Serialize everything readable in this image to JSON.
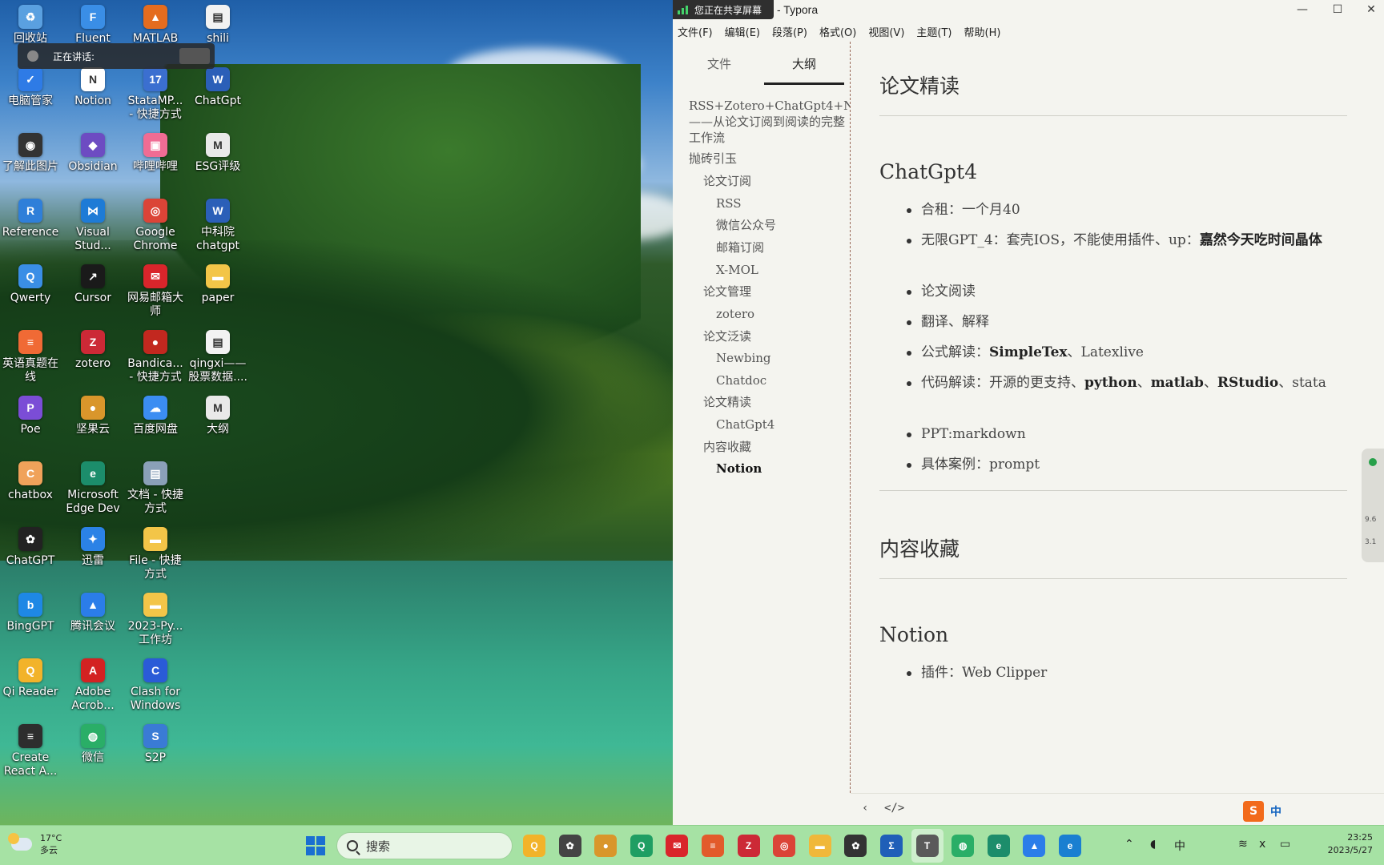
{
  "desktop": {
    "icons": [
      {
        "label": "回收站",
        "icon": "recycle-bin-icon",
        "color": "#5aa0e0",
        "glyph": "♻"
      },
      {
        "label": "电脑管家",
        "icon": "shield-icon",
        "color": "#2e7be6",
        "glyph": "✓"
      },
      {
        "label": "了解此图片",
        "icon": "camera-icon",
        "color": "#333333",
        "glyph": "◉"
      },
      {
        "label": "Reference",
        "icon": "reference-icon",
        "color": "#2f7fd9",
        "glyph": "R"
      },
      {
        "label": "Qwerty",
        "icon": "qwerty-icon",
        "color": "#3a8ee6",
        "glyph": "Q"
      },
      {
        "label": "英语真题在\n线",
        "icon": "exam-icon",
        "color": "#f06a35",
        "glyph": "≡"
      },
      {
        "label": "Poe",
        "icon": "poe-icon",
        "color": "#7b4dd6",
        "glyph": "P"
      },
      {
        "label": "chatbox",
        "icon": "chatbox-icon",
        "color": "#f0a25a",
        "glyph": "C"
      },
      {
        "label": "ChatGPT",
        "icon": "chatgpt-icon",
        "color": "#222222",
        "glyph": "✿"
      },
      {
        "label": "BingGPT",
        "icon": "bing-icon",
        "color": "#1e88e5",
        "glyph": "b"
      },
      {
        "label": "Qi Reader",
        "icon": "qi-reader-icon",
        "color": "#f2b32a",
        "glyph": "Q"
      },
      {
        "label": "Create\nReact A...",
        "icon": "create-react-icon",
        "color": "#2d2d2d",
        "glyph": "≡"
      },
      {
        "label": "Fluent",
        "icon": "fluent-icon",
        "color": "#3a8ee6",
        "glyph": "F"
      },
      {
        "label": "Notion",
        "icon": "notion-icon",
        "color": "#ffffff",
        "glyph": "N"
      },
      {
        "label": "Obsidian",
        "icon": "obsidian-icon",
        "color": "#6d4cc2",
        "glyph": "◆"
      },
      {
        "label": "Visual\nStud...",
        "icon": "vscode-icon",
        "color": "#1e7bd6",
        "glyph": "⋈"
      },
      {
        "label": "Cursor",
        "icon": "cursor-icon",
        "color": "#1a1a1a",
        "glyph": "↗"
      },
      {
        "label": "zotero",
        "icon": "zotero-icon",
        "color": "#cc2936",
        "glyph": "Z"
      },
      {
        "label": "坚果云",
        "icon": "jianguoyun-icon",
        "color": "#d9962b",
        "glyph": "●"
      },
      {
        "label": "Microsoft\nEdge Dev",
        "icon": "edge-dev-icon",
        "color": "#1c8d6b",
        "glyph": "e"
      },
      {
        "label": "迅雷",
        "icon": "xunlei-icon",
        "color": "#2b82e6",
        "glyph": "✦"
      },
      {
        "label": "腾讯会议",
        "icon": "tencent-meeting-icon",
        "color": "#2b7de9",
        "glyph": "▲"
      },
      {
        "label": "Adobe\nAcrob...",
        "icon": "acrobat-icon",
        "color": "#d32222",
        "glyph": "A"
      },
      {
        "label": "微信",
        "icon": "wechat-icon",
        "color": "#2aae67",
        "glyph": "◍"
      },
      {
        "label": "MATLAB",
        "icon": "matlab-icon",
        "color": "#e46c1e",
        "glyph": "▲"
      },
      {
        "label": "StataMP...\n- 快捷方式",
        "icon": "stata-icon",
        "color": "#3b6fd0",
        "glyph": "17"
      },
      {
        "label": "哔哩哔哩",
        "icon": "bilibili-icon",
        "color": "#f06c94",
        "glyph": "▣"
      },
      {
        "label": "Google\nChrome",
        "icon": "chrome-icon",
        "color": "#db4437",
        "glyph": "◎"
      },
      {
        "label": "网易邮箱大\n师",
        "icon": "netease-mail-icon",
        "color": "#d9252b",
        "glyph": "✉"
      },
      {
        "label": "Bandica...\n- 快捷方式",
        "icon": "bandicam-icon",
        "color": "#c2281f",
        "glyph": "●"
      },
      {
        "label": "百度网盘",
        "icon": "baidu-pan-icon",
        "color": "#3b8df2",
        "glyph": "☁"
      },
      {
        "label": "文档 - 快捷\n方式",
        "icon": "documents-icon",
        "color": "#8aa0b8",
        "glyph": "▤"
      },
      {
        "label": "File - 快捷\n方式",
        "icon": "folder-icon",
        "color": "#f3c548",
        "glyph": "▬"
      },
      {
        "label": "2023-Py...\n工作坊",
        "icon": "folder-icon",
        "color": "#f3c548",
        "glyph": "▬"
      },
      {
        "label": "Clash for\nWindows",
        "icon": "clash-icon",
        "color": "#2a5bd7",
        "glyph": "C"
      },
      {
        "label": "S2P",
        "icon": "s2p-icon",
        "color": "#3a7bd5",
        "glyph": "S"
      },
      {
        "label": "shili",
        "icon": "document-icon",
        "color": "#f2f2f2",
        "glyph": "▤"
      },
      {
        "label": "ChatGpt",
        "icon": "word-icon",
        "color": "#2b5fb8",
        "glyph": "W"
      },
      {
        "label": "ESG评级",
        "icon": "markdown-icon",
        "color": "#e9e9e9",
        "glyph": "M"
      },
      {
        "label": "中科院\nchatgpt",
        "icon": "word-icon",
        "color": "#2b5fb8",
        "glyph": "W"
      },
      {
        "label": "paper",
        "icon": "folder-icon",
        "color": "#f3c548",
        "glyph": "▬"
      },
      {
        "label": "qingxi——\n股票数据....",
        "icon": "document-icon",
        "color": "#f2f2f2",
        "glyph": "▤"
      },
      {
        "label": "大纲",
        "icon": "markdown-icon",
        "color": "#e9e9e9",
        "glyph": "M"
      }
    ],
    "talking_toast": "正在讲话:"
  },
  "window": {
    "share_badge": "您正在共享屏幕",
    "title": "- Typora",
    "controls": {
      "minimize": "—",
      "maximize": "☐",
      "close": "✕"
    },
    "menu": [
      "文件(F)",
      "编辑(E)",
      "段落(P)",
      "格式(O)",
      "视图(V)",
      "主题(T)",
      "帮助(H)"
    ],
    "sidebar": {
      "tabs": [
        {
          "label": "文件",
          "active": false
        },
        {
          "label": "大纲",
          "active": true
        }
      ],
      "outline": [
        {
          "text": "RSS+Zotero+ChatGpt4+Notion",
          "level": 1,
          "line": 0,
          "active": false
        },
        {
          "text": "——从论文订阅到阅读的完整",
          "level": 1,
          "line": 1,
          "active": false
        },
        {
          "text": "工作流",
          "level": 1,
          "line": 2,
          "active": false
        },
        {
          "text": "抛砖引玉",
          "level": 1,
          "line": 3,
          "active": false
        },
        {
          "text": "论文订阅",
          "level": 2,
          "line": 4,
          "active": false
        },
        {
          "text": "RSS",
          "level": 3,
          "line": 5,
          "active": false
        },
        {
          "text": "微信公众号",
          "level": 3,
          "line": 6,
          "active": false
        },
        {
          "text": "邮箱订阅",
          "level": 3,
          "line": 7,
          "active": false
        },
        {
          "text": "X-MOL",
          "level": 3,
          "line": 8,
          "active": false
        },
        {
          "text": "论文管理",
          "level": 2,
          "line": 9,
          "active": false
        },
        {
          "text": "zotero",
          "level": 3,
          "line": 10,
          "active": false
        },
        {
          "text": "论文泛读",
          "level": 2,
          "line": 11,
          "active": false
        },
        {
          "text": "Newbing",
          "level": 3,
          "line": 12,
          "active": false
        },
        {
          "text": "Chatdoc",
          "level": 3,
          "line": 13,
          "active": false
        },
        {
          "text": "论文精读",
          "level": 2,
          "line": 14,
          "active": false
        },
        {
          "text": "ChatGpt4",
          "level": 3,
          "line": 15,
          "active": false
        },
        {
          "text": "内容收藏",
          "level": 2,
          "line": 16,
          "active": false
        },
        {
          "text": "Notion",
          "level": 3,
          "line": 17,
          "active": true
        }
      ]
    },
    "document": {
      "sections": [
        {
          "heading": "论文精读",
          "size": "h2"
        },
        {
          "heading": "ChatGpt4",
          "size": "h3",
          "bullets": [
            [
              "合租：一个月40"
            ],
            [
              "无限GPT_4：套壳IOS，不能使用插件、up：",
              "嘉然今天吃时间晶体"
            ],
            [
              "论文阅读"
            ],
            [
              "翻译、解释"
            ],
            [
              "公式解读：",
              "SimpleTex",
              "、Latexlive"
            ],
            [
              "代码解读：开源的更支持、",
              "python",
              "、",
              "matlab",
              "、",
              "RStudio",
              "、stata"
            ],
            [
              "PPT:markdown"
            ],
            [
              "具体案例：prompt"
            ]
          ]
        },
        {
          "heading": "内容收藏",
          "size": "h2"
        },
        {
          "heading": "Notion",
          "size": "h3",
          "bullets": [
            [
              "插件：Web Clipper"
            ]
          ]
        }
      ]
    },
    "statusbar": {
      "back": "‹",
      "source_mode": "</>"
    },
    "side_widget": {
      "val1": "9.6",
      "val2": "3.1"
    }
  },
  "taskbar": {
    "weather": {
      "temp": "17°C",
      "desc": "多云"
    },
    "search_placeholder": "搜索",
    "apps": [
      {
        "icon": "qi-reader-icon",
        "color": "#f2b32a",
        "glyph": "Q"
      },
      {
        "icon": "chatgpt-icon",
        "color": "#444444",
        "glyph": "✿"
      },
      {
        "icon": "jianguoyun-icon",
        "color": "#d9962b",
        "glyph": "●"
      },
      {
        "icon": "qq-browser-icon",
        "color": "#1f9e63",
        "glyph": "Q"
      },
      {
        "icon": "netease-mail-icon",
        "color": "#d9252b",
        "glyph": "✉"
      },
      {
        "icon": "exam-icon",
        "color": "#e25b2b",
        "glyph": "≡"
      },
      {
        "icon": "zotero-icon",
        "color": "#cc2936",
        "glyph": "Z"
      },
      {
        "icon": "chrome-icon",
        "color": "#db4437",
        "glyph": "◎"
      },
      {
        "icon": "file-explorer-icon",
        "color": "#f0b83a",
        "glyph": "▬"
      },
      {
        "icon": "chatgpt-icon",
        "color": "#333333",
        "glyph": "✿"
      },
      {
        "icon": "stata-icon",
        "color": "#1f5fb8",
        "glyph": "Σ"
      },
      {
        "icon": "typora-icon",
        "color": "#5a5a5a",
        "glyph": "T"
      },
      {
        "icon": "wechat-icon",
        "color": "#2aae67",
        "glyph": "◍"
      },
      {
        "icon": "edge-dev-icon",
        "color": "#1c8d6b",
        "glyph": "e"
      },
      {
        "icon": "tencent-meeting-icon",
        "color": "#2b7de9",
        "glyph": "▲"
      },
      {
        "icon": "edge-icon",
        "color": "#1a7fd1",
        "glyph": "e"
      }
    ],
    "tray": {
      "ime": "中",
      "volume": "ⅹ",
      "time": "23:25",
      "date": "2023/5/27"
    }
  }
}
